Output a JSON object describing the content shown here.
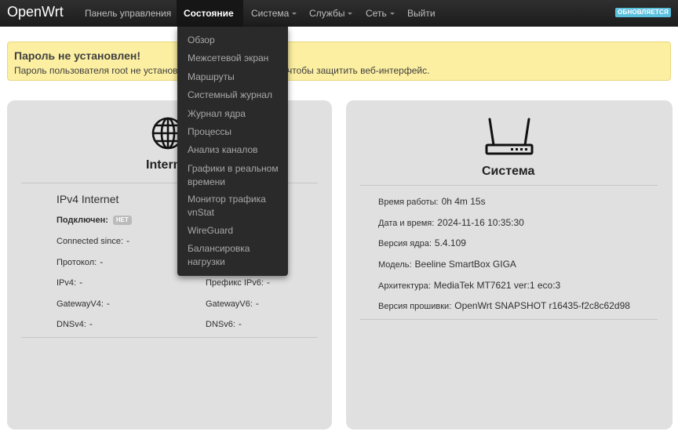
{
  "brand": "OpenWrt",
  "nav": {
    "items": [
      {
        "label": "Панель управления",
        "dropdown": false
      },
      {
        "label": "Состояние",
        "dropdown": true,
        "active": true
      },
      {
        "label": "Система",
        "dropdown": true
      },
      {
        "label": "Службы",
        "dropdown": true
      },
      {
        "label": "Сеть",
        "dropdown": true
      },
      {
        "label": "Выйти",
        "dropdown": false
      }
    ],
    "status_label": "ОБНОВЛЯЕТСЯ"
  },
  "alert": {
    "title": "Пароль не установлен!",
    "text": "Пароль пользователя root не установлен. Установите пароль, чтобы защитить веб-интерфейс."
  },
  "dropdown": {
    "items": [
      "Обзор",
      "Межсетевой экран",
      "Маршруты",
      "Системный журнал",
      "Журнал ядра",
      "Процессы",
      "Анализ каналов",
      "Графики в реальном времени",
      "Монитор трафика vnStat",
      "WireGuard",
      "Балансировка нагрузки"
    ]
  },
  "internet": {
    "title": "Internet",
    "section": "IPv4 Internet",
    "connected_label": "Подключен:",
    "connected_value": "НЕТ",
    "rows_left": [
      {
        "k": "Connected since:",
        "v": "-"
      },
      {
        "k": "Протокол:",
        "v": "-"
      },
      {
        "k": "IPv4:",
        "v": "-"
      },
      {
        "k": "GatewayV4:",
        "v": "-"
      },
      {
        "k": "DNSv4:",
        "v": "-"
      }
    ],
    "rows_right": [
      {
        "k": "Префикс IPv6:",
        "v": "-"
      },
      {
        "k": "GatewayV6:",
        "v": "-"
      },
      {
        "k": "DNSv6:",
        "v": "-"
      }
    ]
  },
  "system": {
    "title": "Система",
    "rows": [
      {
        "k": "Время работы:",
        "v": "0h 4m 15s"
      },
      {
        "k": "Дата и время:",
        "v": "2024-11-16 10:35:30"
      },
      {
        "k": "Версия ядра:",
        "v": "5.4.109"
      },
      {
        "k": "Модель:",
        "v": "Beeline SmartBox GIGA"
      },
      {
        "k": "Архитектура:",
        "v": "MediaTek MT7621 ver:1 eco:3"
      },
      {
        "k": "Версия прошивки:",
        "v": "OpenWrt SNAPSHOT r16435-f2c8c62d98"
      }
    ]
  },
  "colors": {
    "navbar": "#222222",
    "alert_bg": "#fcefa1",
    "card_bg": "#e0e0e0",
    "status_label": "#5bc0de"
  },
  "icons": {
    "internet": "globe-icon",
    "system": "router-icon"
  }
}
